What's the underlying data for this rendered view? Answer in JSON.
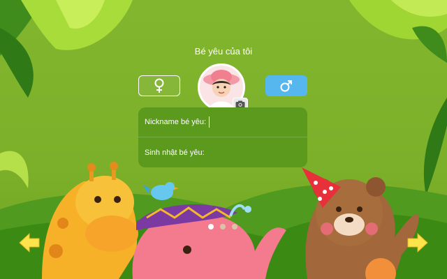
{
  "header": {
    "title": "Bé yêu của tôi"
  },
  "gender": {
    "female_icon": "female-symbol-icon",
    "male_icon": "male-symbol-icon",
    "selected": "male",
    "selected_color": "#56b7ee"
  },
  "avatar": {
    "camera_icon": "camera-icon"
  },
  "form": {
    "nickname_label": "Nickname bé yêu:",
    "nickname_value": "",
    "birthday_label": "Sinh nhật bé yêu:",
    "birthday_value": ""
  },
  "pager": {
    "count": 3,
    "active_index": 0
  },
  "nav": {
    "prev_icon": "arrow-left-icon",
    "next_icon": "arrow-right-icon",
    "arrow_color": "#ffe34d"
  },
  "colors": {
    "background": "#7fb32c",
    "form_panel": "#5c9a1e",
    "accent_blue": "#56b7ee"
  }
}
